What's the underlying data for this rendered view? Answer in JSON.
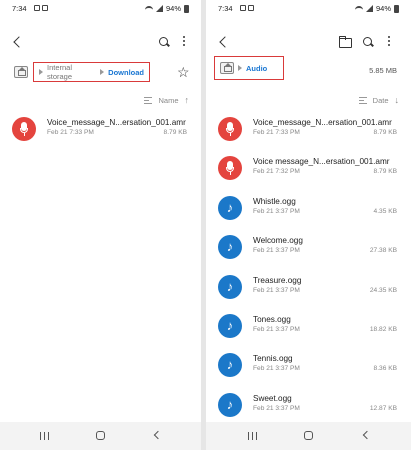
{
  "left": {
    "status": {
      "time": "7:34",
      "battery": "94%"
    },
    "breadcrumb": {
      "root": "Internal storage",
      "current": "Download"
    },
    "sort": {
      "label": "Name",
      "direction_icon": "arrow-up"
    },
    "files": [
      {
        "name": "Voice_message_N...ersation_001.amr",
        "date": "Feb 21 7:33 PM",
        "size": "8.79 KB",
        "type": "recording"
      }
    ]
  },
  "right": {
    "status": {
      "time": "7:34",
      "battery": "94%"
    },
    "breadcrumb": {
      "current": "Audio"
    },
    "storage_size": "5.85 MB",
    "sort": {
      "label": "Date",
      "direction_icon": "arrow-down"
    },
    "files": [
      {
        "name": "Voice_message_N...ersation_001.amr",
        "date": "Feb 21 7:33 PM",
        "size": "8.79 KB",
        "type": "recording"
      },
      {
        "name": "Voice message_N...ersation_001.amr",
        "date": "Feb 21 7:32 PM",
        "size": "8.79 KB",
        "type": "recording"
      },
      {
        "name": "Whistle.ogg",
        "date": "Feb 21 3:37 PM",
        "size": "4.35 KB",
        "type": "audio"
      },
      {
        "name": "Welcome.ogg",
        "date": "Feb 21 3:37 PM",
        "size": "27.38 KB",
        "type": "audio"
      },
      {
        "name": "Treasure.ogg",
        "date": "Feb 21 3:37 PM",
        "size": "24.35 KB",
        "type": "audio"
      },
      {
        "name": "Tones.ogg",
        "date": "Feb 21 3:37 PM",
        "size": "18.82 KB",
        "type": "audio"
      },
      {
        "name": "Tennis.ogg",
        "date": "Feb 21 3:37 PM",
        "size": "8.36 KB",
        "type": "audio"
      },
      {
        "name": "Sweet.ogg",
        "date": "Feb 21 3:37 PM",
        "size": "12.87 KB",
        "type": "audio"
      }
    ]
  },
  "colors": {
    "highlight_border": "#d93a3a",
    "accent_blue": "#1976d2",
    "recording_icon": "#e4443e",
    "audio_icon": "#1b78c9"
  }
}
